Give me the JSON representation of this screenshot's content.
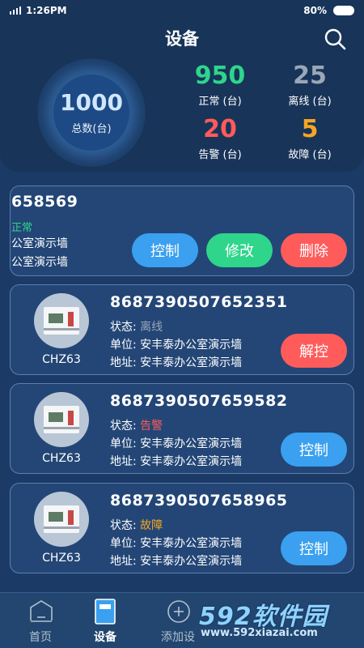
{
  "status_bar": {
    "time": "1:26PM",
    "battery": "80%"
  },
  "header": {
    "title": "设备"
  },
  "summary": {
    "total": {
      "value": "1000",
      "label": "总数(台)"
    },
    "normal": {
      "value": "950",
      "label": "正常 (台)",
      "color": "#2fd58b"
    },
    "offline": {
      "value": "25",
      "label": "离线 (台)",
      "color": "#9aa7b6"
    },
    "alarm": {
      "value": "20",
      "label": "告警 (台)",
      "color": "#ff5b5b"
    },
    "fault": {
      "value": "5",
      "label": "故障 (台)",
      "color": "#f5a623"
    }
  },
  "first_card": {
    "id": "658569",
    "status": "正常",
    "status_color": "#2fd58b",
    "line1": "公室演示墙",
    "line2": "公室演示墙",
    "buttons": {
      "control": "控制",
      "edit": "修改",
      "delete": "删除"
    }
  },
  "devices": [
    {
      "model": "CHZ63",
      "id": "8687390507652351",
      "status_label": "状态:",
      "status": "离线",
      "status_color": "#9aa7b6",
      "unit": "单位: 安丰泰办公室演示墙",
      "address": "地址: 安丰泰办公室演示墙",
      "action": "解控",
      "action_color": "#ff5b5b"
    },
    {
      "model": "CHZ63",
      "id": "8687390507659582",
      "status_label": "状态:",
      "status": "告警",
      "status_color": "#ff5b5b",
      "unit": "单位: 安丰泰办公室演示墙",
      "address": "地址: 安丰泰办公室演示墙",
      "action": "控制",
      "action_color": "#3aa0ef"
    },
    {
      "model": "CHZ63",
      "id": "8687390507658965",
      "status_label": "状态:",
      "status": "故障",
      "status_color": "#f5a623",
      "unit": "单位: 安丰泰办公室演示墙",
      "address": "地址: 安丰泰办公室演示墙",
      "action": "控制",
      "action_color": "#3aa0ef"
    }
  ],
  "tabs": [
    {
      "label": "首页",
      "icon": "home-icon"
    },
    {
      "label": "设备",
      "icon": "device-icon"
    },
    {
      "label": "添加设",
      "icon": "add-icon"
    }
  ],
  "watermark": {
    "logo": "592软件园",
    "url": "www.592xiazai.com"
  },
  "colors": {
    "primary": "#3aa0ef",
    "green": "#2fd58b",
    "red": "#ff5b5b",
    "bg": "#1c3a66"
  }
}
